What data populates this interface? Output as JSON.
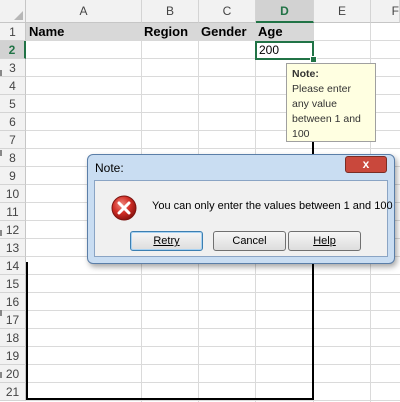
{
  "columns": [
    "A",
    "B",
    "C",
    "D",
    "E",
    "F"
  ],
  "rows": [
    "1",
    "2",
    "3",
    "4",
    "5",
    "6",
    "7",
    "8",
    "9",
    "10",
    "11",
    "12",
    "13",
    "14",
    "15",
    "16",
    "17",
    "18",
    "19",
    "20",
    "21"
  ],
  "header_row": {
    "name": "Name",
    "region": "Region",
    "gender": "Gender",
    "age": "Age"
  },
  "active_cell_value": "200",
  "selected_column": "D",
  "selected_row": "2",
  "tooltip": {
    "title": "Note:",
    "text": "Please enter any value between 1 and 100"
  },
  "dialog": {
    "title": "Note:",
    "close_glyph": "x",
    "message": "You can only enter the values between 1 and 100",
    "buttons": {
      "retry": "Retry",
      "cancel": "Cancel",
      "help": "Help"
    },
    "icon": "error-icon"
  },
  "colors": {
    "selection_green": "#217346",
    "tooltip_bg": "#ffffe1",
    "dialog_frame": "#c9ddf2",
    "close_button": "#c9483c",
    "error_red": "#d22f27"
  }
}
